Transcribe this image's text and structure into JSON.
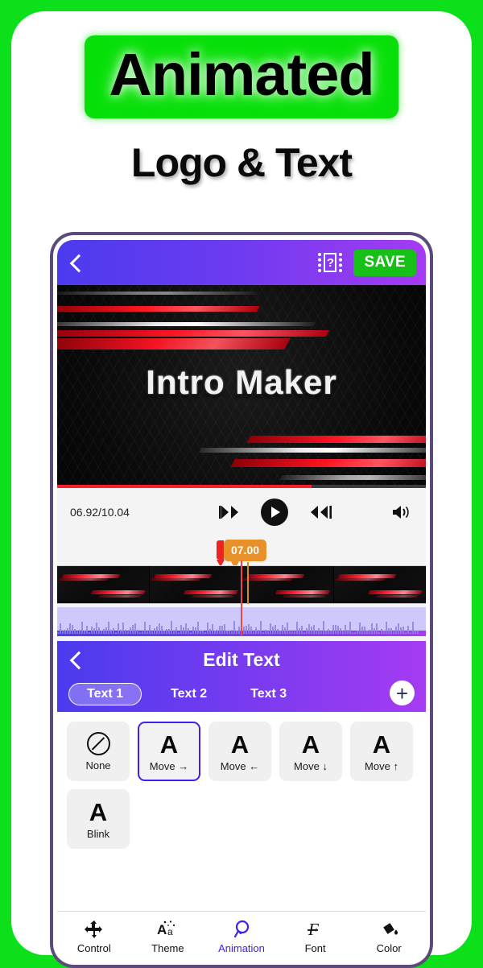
{
  "promo": {
    "headline": "Animated",
    "subhead": "Logo & Text",
    "badge_color": "#07E008",
    "border_color": "#0BE01B"
  },
  "appbar": {
    "back_icon": "back-chevron-icon",
    "help_icon": "film-question-icon",
    "help_label": "?",
    "save_label": "SAVE",
    "save_color": "#17C017",
    "gradient_from": "#4B3BEE",
    "gradient_to": "#A53BF2"
  },
  "preview": {
    "title": "Intro Maker"
  },
  "player": {
    "time_label": "06.92/10.04",
    "progress_percent": 69,
    "prev_icon": "skip-previous-icon",
    "play_icon": "play-icon",
    "next_icon": "skip-next-icon",
    "volume_icon": "volume-icon"
  },
  "timeline": {
    "marker_time": "07.00",
    "marker_color": "#E8912B",
    "tag_color": "#EE2222",
    "playhead_color": "#F04545",
    "frames": 4
  },
  "edit_panel": {
    "back_icon": "back-chevron-icon",
    "title": "Edit Text",
    "add_icon": "plus-icon",
    "tabs": [
      {
        "label": "Text 1",
        "active": true
      },
      {
        "label": "Text 2",
        "active": false
      },
      {
        "label": "Text 3",
        "active": false
      }
    ]
  },
  "animations": [
    {
      "label": "None",
      "glyph": "",
      "icon": "no-animation-icon",
      "selected": false
    },
    {
      "label": "Move →",
      "glyph": "A",
      "icon": "text-a-icon",
      "selected": true
    },
    {
      "label": "Move ←",
      "glyph": "A",
      "icon": "text-a-icon",
      "selected": false
    },
    {
      "label": "Move ↓",
      "glyph": "A",
      "icon": "text-a-icon",
      "selected": false
    },
    {
      "label": "Move ↑",
      "glyph": "A",
      "icon": "text-a-icon",
      "selected": false
    },
    {
      "label": "Blink",
      "glyph": "A",
      "icon": "text-a-icon",
      "selected": false
    }
  ],
  "bottom_nav": [
    {
      "label": "Control",
      "icon": "move-arrows-icon",
      "active": false
    },
    {
      "label": "Theme",
      "icon": "theme-aa-icon",
      "active": false
    },
    {
      "label": "Animation",
      "icon": "animation-icon",
      "active": true
    },
    {
      "label": "Font",
      "icon": "font-f-icon",
      "active": false
    },
    {
      "label": "Color",
      "icon": "paint-bucket-icon",
      "active": false
    }
  ],
  "accent": {
    "selected": "#3B22EE",
    "purple": "#7B3BF0"
  }
}
